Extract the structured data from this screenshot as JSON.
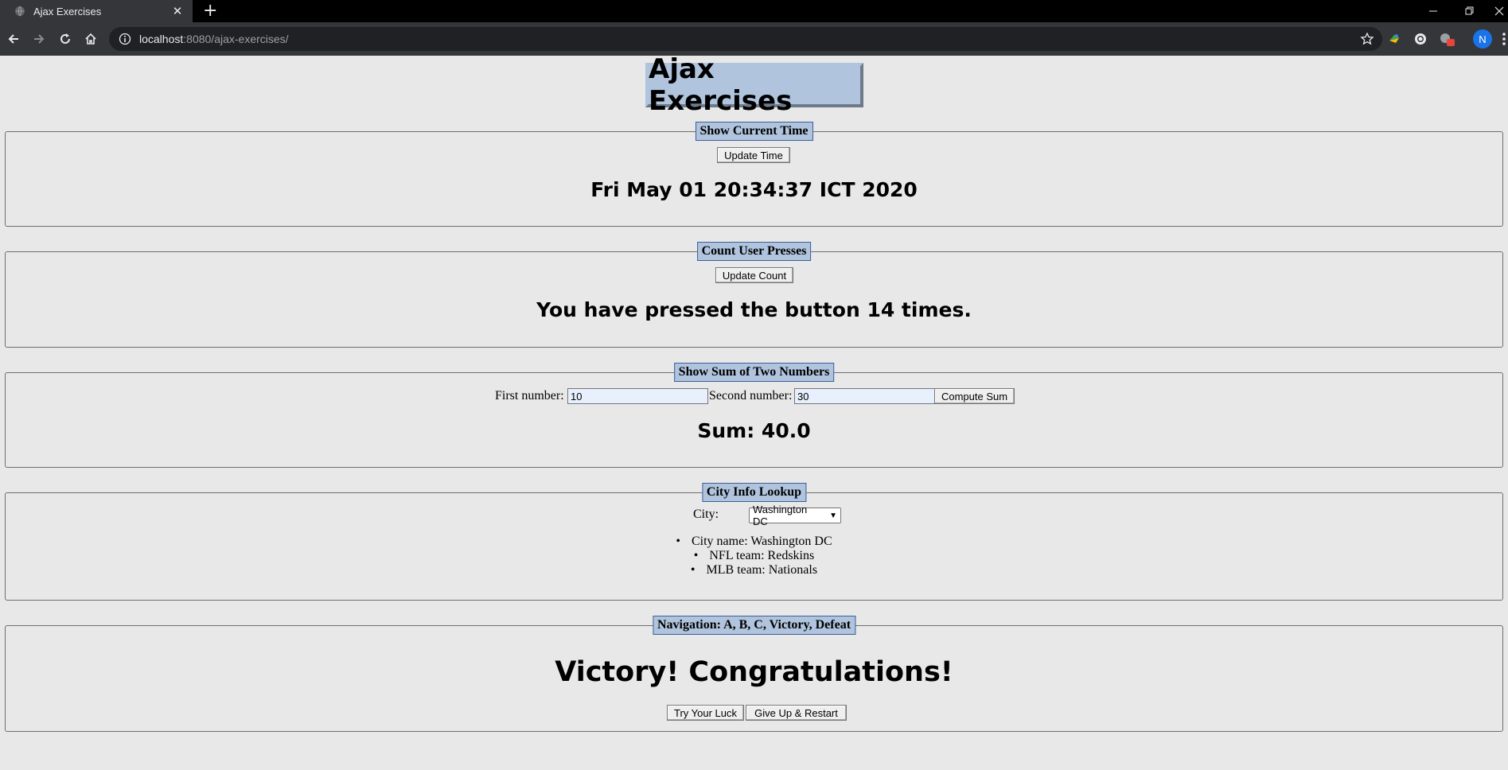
{
  "browser": {
    "tab_title": "Ajax Exercises",
    "url_host": "localhost",
    "url_path": ":8080/ajax-exercises/",
    "avatar_letter": "N"
  },
  "page": {
    "title": "Ajax Exercises"
  },
  "time_panel": {
    "legend": "Show Current Time",
    "button": "Update Time",
    "result": "Fri May 01 20:34:37 ICT 2020"
  },
  "count_panel": {
    "legend": "Count User Presses",
    "button": "Update Count",
    "result": "You have pressed the button 14 times."
  },
  "sum_panel": {
    "legend": "Show Sum of Two Numbers",
    "first_label": "First number:",
    "first_value": "10",
    "second_label": "Second number:",
    "second_value": "30",
    "button": "Compute Sum",
    "result": "Sum: 40.0"
  },
  "city_panel": {
    "legend": "City Info Lookup",
    "city_label": "City:",
    "selected_city": "Washington DC",
    "info": [
      "City name: Washington DC",
      "NFL team: Redskins",
      "MLB team: Nationals"
    ]
  },
  "nav_panel": {
    "legend": "Navigation: A, B, C, Victory, Defeat",
    "result": "Victory! Congratulations!",
    "try_button": "Try Your Luck",
    "restart_button": "Give Up & Restart"
  },
  "colors": {
    "legend_bg": "#b0c4de",
    "page_bg": "#e8e8e8",
    "chrome_bg": "#35363a"
  }
}
